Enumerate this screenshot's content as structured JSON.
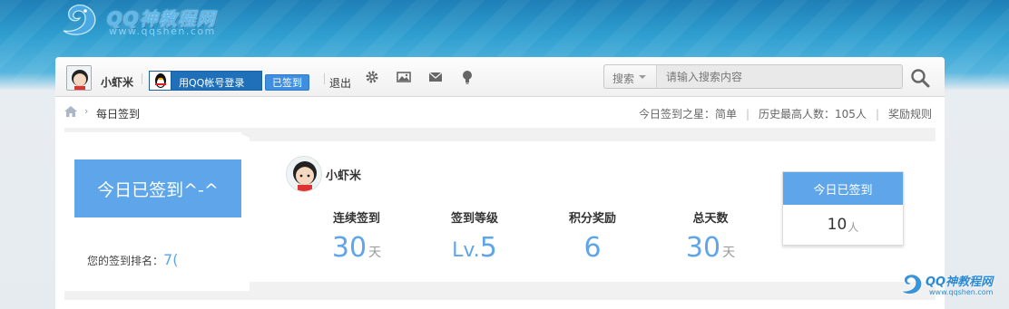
{
  "logo": {
    "brand": "QQ神教程网",
    "url": "www.qqshen.com"
  },
  "topbar": {
    "username": "小虾米",
    "qq_login_label": "用QQ帐号登录",
    "signed_label": "已签到",
    "logout_label": "退出",
    "icons": [
      "gear-icon",
      "image-icon",
      "mail-icon",
      "bulb-icon"
    ]
  },
  "search": {
    "select_label": "搜索",
    "placeholder": "请输入搜索内容"
  },
  "breadcrumb": {
    "current": "每日签到",
    "separator": "›"
  },
  "stats": {
    "star_label": "今日签到之星：简单",
    "record_label": "历史最高人数：105人",
    "rules_label": "奖励规则"
  },
  "left": {
    "sign_button": "今日已签到^-^",
    "rank_label": "您的签到排名：",
    "rank_value": "7("
  },
  "main": {
    "username": "小虾米",
    "metrics": [
      {
        "label": "连续签到",
        "value": "30",
        "unit": "天"
      },
      {
        "label": "签到等级",
        "value_prefix": "Lv.",
        "value": "5",
        "unit": ""
      },
      {
        "label": "积分奖励",
        "value": "6",
        "unit": ""
      },
      {
        "label": "总天数",
        "value": "30",
        "unit": "天"
      }
    ],
    "today": {
      "header": "今日已签到",
      "count": "10",
      "unit": "人"
    }
  },
  "watermark": {
    "brand": "QQ神教程网",
    "url": "www.qqshen.com"
  },
  "colors": {
    "accent": "#5ea5ea",
    "header_blue": "#2f9fd0"
  }
}
